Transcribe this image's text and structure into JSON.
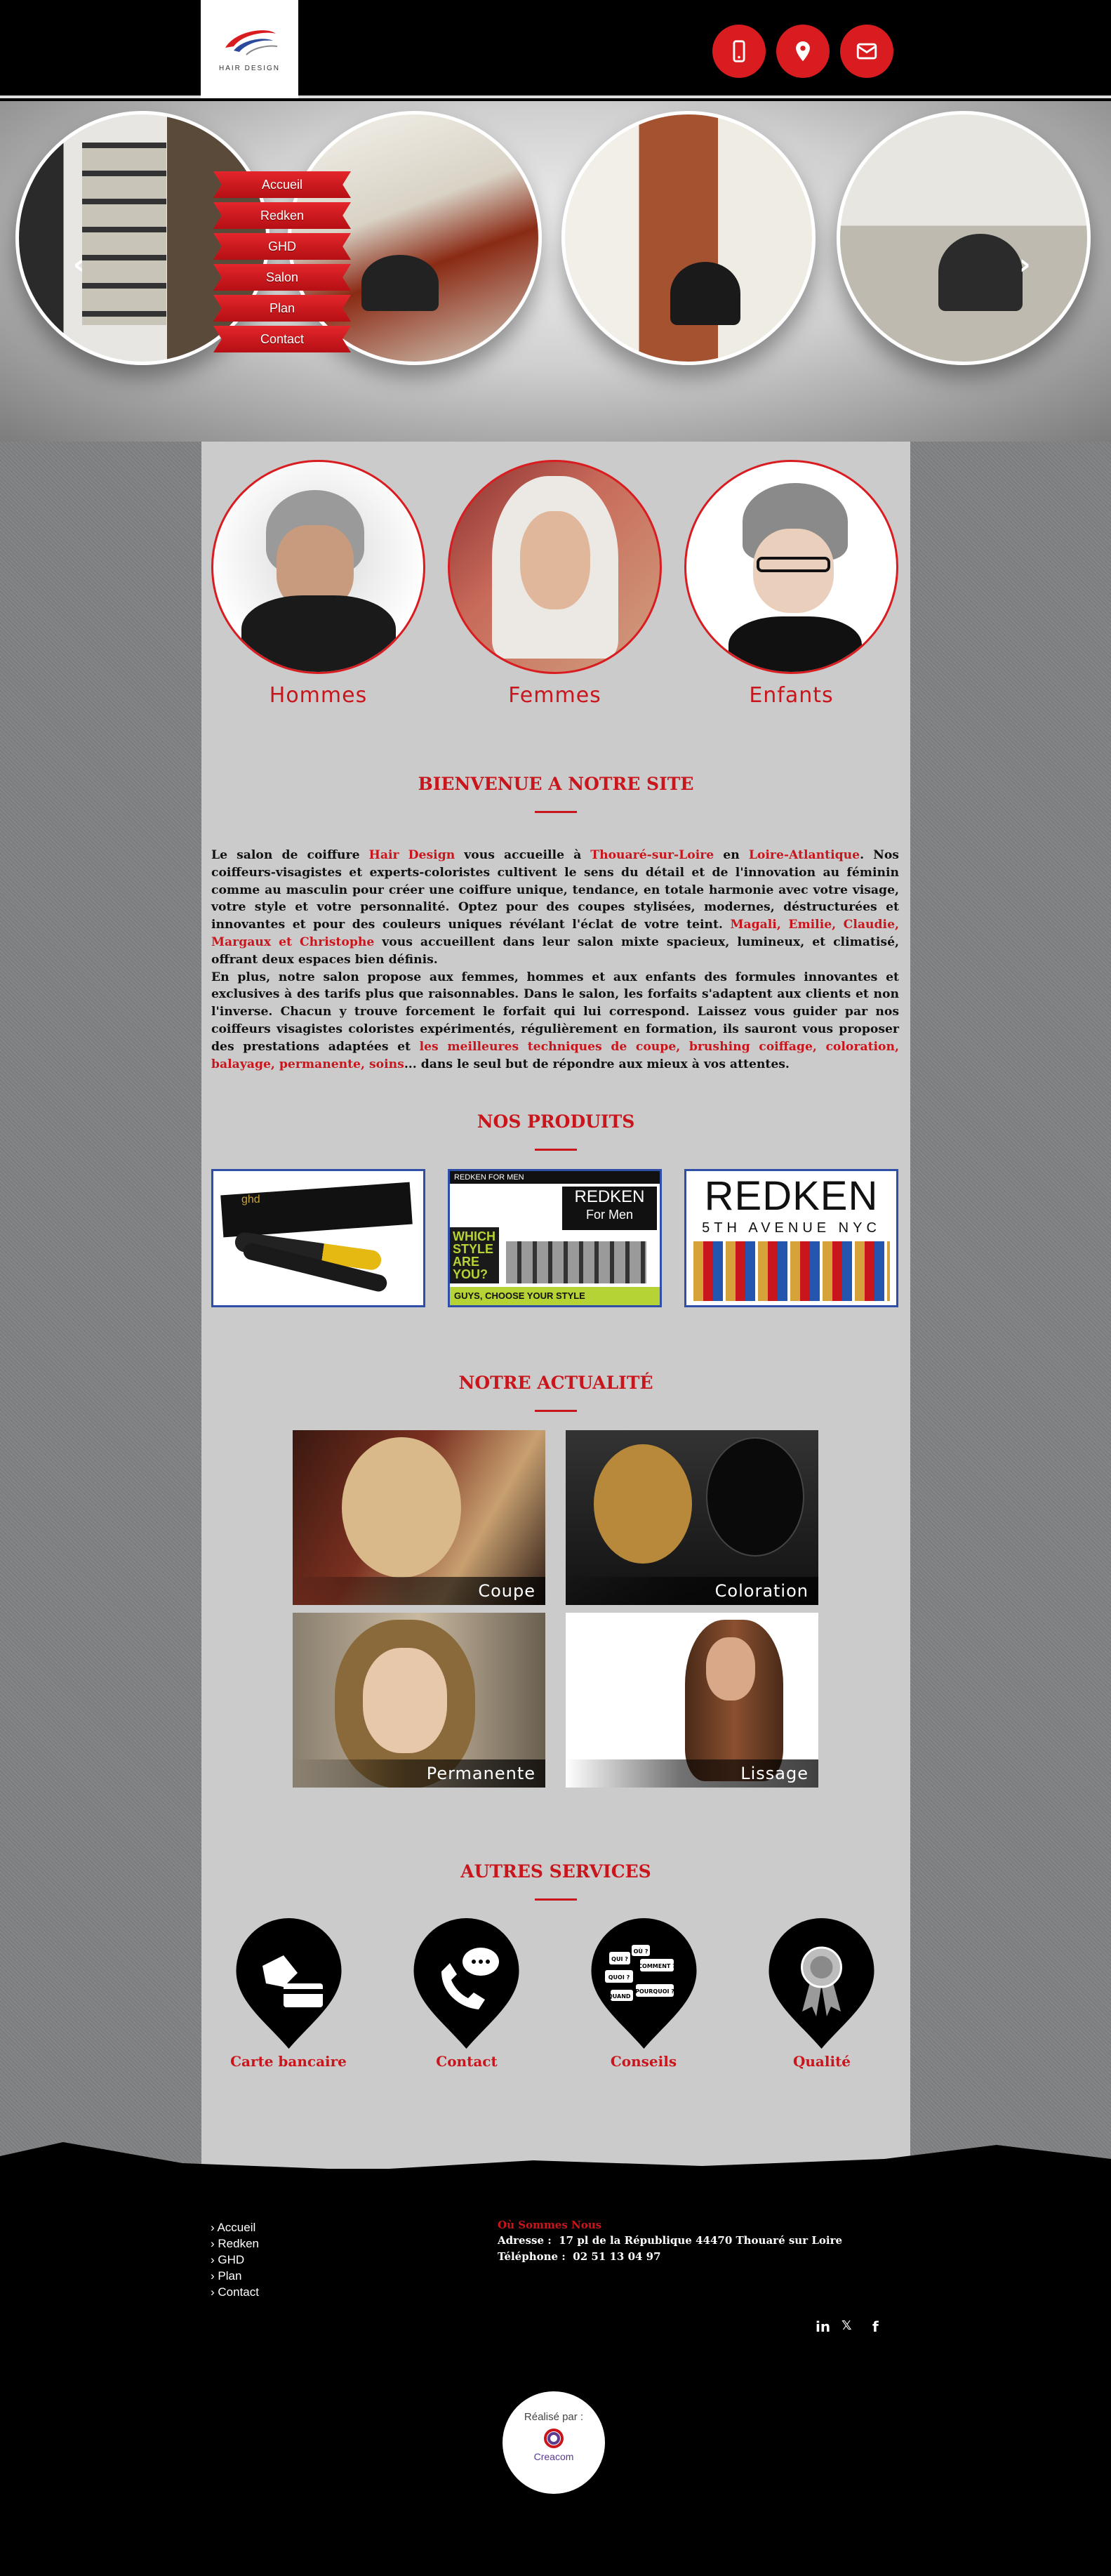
{
  "header": {
    "logo_text": "HAIR DESIGN",
    "phone_icon": "phone-icon",
    "map_icon": "map-pin-icon",
    "mail_icon": "mail-icon",
    "accent_color": "#d81c20"
  },
  "slider": {
    "menu": [
      "Accueil",
      "Redken",
      "GHD",
      "Salon",
      "Plan",
      "Contact"
    ],
    "prev_arrow": "‹",
    "next_arrow": "›"
  },
  "categories": [
    "Hommes",
    "Femmes",
    "Enfants"
  ],
  "welcome": {
    "title": "BIENVENUE A NOTRE SITE",
    "p1_a": "Le salon de coiffure ",
    "p1_b": "Hair Design",
    "p1_c": " vous accueille à ",
    "p1_d": "Thouaré-sur-Loire",
    "p1_e": " en ",
    "p1_f": "Loire-Atlantique",
    "p1_g": ". Nos coiffeurs-visagistes et experts-coloristes cultivent le sens du détail et de l'innovation au féminin comme au masculin pour créer une coiffure unique, tendance, en totale harmonie avec votre visage, votre style et votre personnalité. Optez pour des coupes stylisées, modernes, déstructurées et innovantes et pour des couleurs uniques révélant l'éclat de votre teint. ",
    "p1_h": "Magali, Emilie, Claudie, Margaux et Christophe",
    "p1_i": " vous accueillent dans leur salon mixte spacieux, lumineux, et climatisé, offrant deux espaces bien définis.",
    "p2_a": "En plus, notre salon propose aux femmes, hommes et aux enfants des formules innovantes et exclusives à des tarifs plus que raisonnables. Dans le salon, les forfaits s'adaptent aux clients et non l'inverse. Chacun y trouve forcement le forfait qui lui correspond. Laissez vous guider par nos coiffeurs visagistes coloristes expérimentés, régulièrement en formation, ils sauront vous proposer des prestations adaptées et ",
    "p2_b": "les meilleures techniques de coupe, brushing coiffage, coloration, balayage, permanente, soins",
    "p2_c": "... dans le seul but de répondre aux mieux à vos attentes."
  },
  "products": {
    "title": "NOS PRODUITS",
    "p2_header": "REDKEN FOR MEN",
    "p2_brand": "REDKEN",
    "p2_sub": "For Men",
    "p2_slogan": "WHICH STYLE ARE YOU?",
    "p2_bottom": "GUYS, CHOOSE YOUR STYLE",
    "p3_brand": "REDKEN",
    "p3_sub": "5TH AVENUE NYC",
    "p1_brand": "ghd"
  },
  "news": {
    "title": "NOTRE ACTUALITÉ",
    "items": [
      "Coupe",
      "Coloration",
      "Permanente",
      "Lissage"
    ]
  },
  "services": {
    "title": "AUTRES SERVICES",
    "items": [
      "Carte bancaire",
      "Contact",
      "Conseils",
      "Qualité"
    ],
    "bubbles": [
      "QUI ?",
      "COMMENT ?",
      "QUOI ?",
      "OÙ ?",
      "POURQUOI ?",
      "QUAND ?"
    ]
  },
  "footer": {
    "links": [
      "Accueil",
      "Redken",
      "GHD",
      "Plan",
      "Contact"
    ],
    "where_title": "Où Sommes Nous",
    "address_label": "Adresse :",
    "address": "17 pl de la République 44470 Thouaré sur Loire",
    "phone_label": "Téléphone :",
    "phone": "02 51 13 04 97",
    "social": [
      "in",
      "𝕏",
      "f"
    ],
    "credit_label": "Réalisé par :",
    "credit_brand": "Creacom"
  }
}
